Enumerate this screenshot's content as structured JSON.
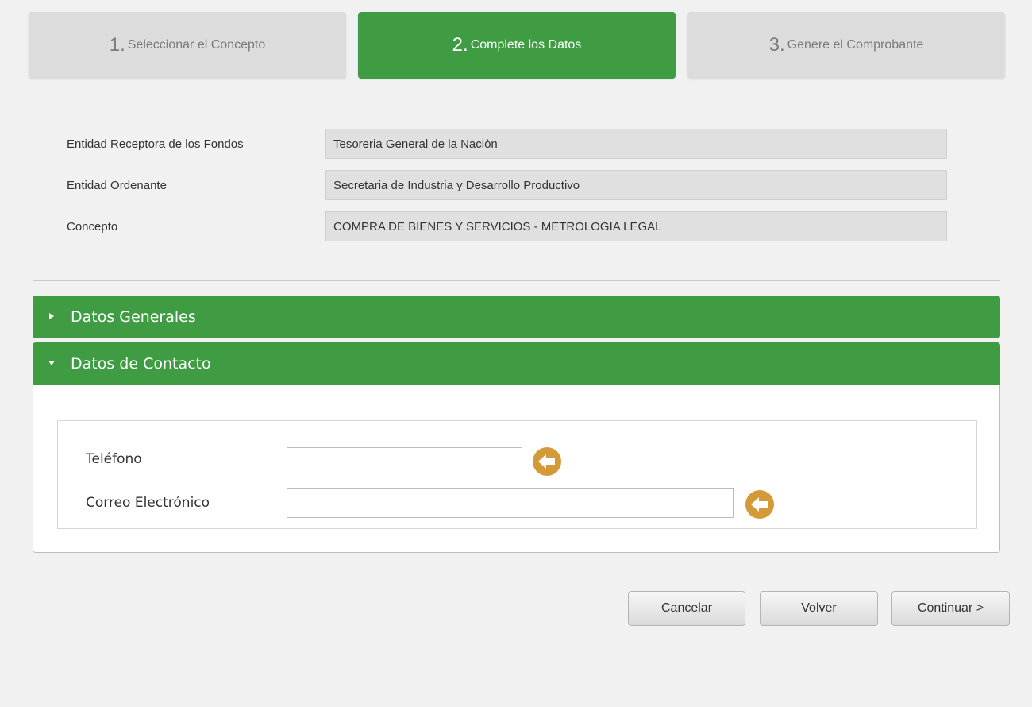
{
  "steps": [
    {
      "number": "1.",
      "label": "Seleccionar el Concepto"
    },
    {
      "number": "2.",
      "label": "Complete los Datos"
    },
    {
      "number": "3.",
      "label": "Genere el Comprobante"
    }
  ],
  "summary": [
    {
      "label": "Entidad Receptora de los Fondos",
      "value": "Tesoreria General de la Naciòn"
    },
    {
      "label": "Entidad Ordenante",
      "value": "Secretaria de Industria y Desarrollo Productivo"
    },
    {
      "label": "Concepto",
      "value": "COMPRA DE BIENES Y SERVICIOS - METROLOGIA LEGAL"
    }
  ],
  "sections": {
    "general": {
      "title": "Datos Generales",
      "state": "collapsed"
    },
    "contact": {
      "title": "Datos de Contacto",
      "state": "expanded"
    }
  },
  "contact_form": {
    "phone_label": "Teléfono",
    "phone_value": "",
    "email_label": "Correo Electrónico",
    "email_value": ""
  },
  "buttons": {
    "cancel": "Cancelar",
    "back": "Volver",
    "next": "Continuar >"
  },
  "colors": {
    "accent_green": "#3f9c43",
    "arrow_gold": "#d49a3a"
  },
  "icons": {
    "collapsed_toggle": "triangle-right-icon",
    "expanded_toggle": "triangle-down-icon",
    "field_pointer": "arrow-left-circle-icon"
  }
}
